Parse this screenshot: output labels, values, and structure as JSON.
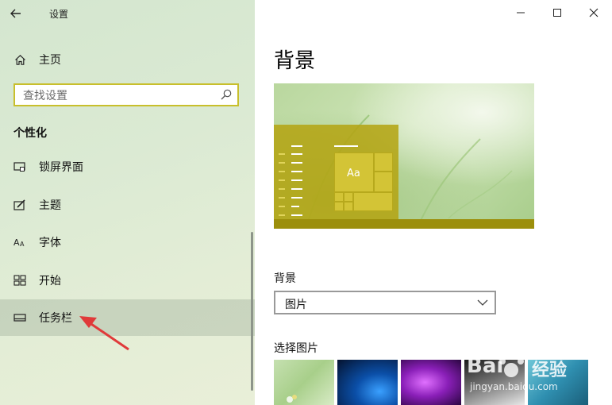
{
  "window": {
    "title": "设置",
    "back_icon": "back-arrow-icon",
    "minimize_glyph": "—",
    "maximize_glyph": "☐",
    "close_glyph": "✕"
  },
  "sidebar": {
    "home_label": "主页",
    "search_placeholder": "查找设置",
    "section_title": "个性化",
    "items": [
      {
        "label": "锁屏界面",
        "icon": "lock-screen-icon"
      },
      {
        "label": "主题",
        "icon": "theme-brush-icon"
      },
      {
        "label": "字体",
        "icon": "font-aa-icon"
      },
      {
        "label": "开始",
        "icon": "start-tiles-icon"
      },
      {
        "label": "任务栏",
        "icon": "taskbar-icon",
        "active": true
      }
    ]
  },
  "main": {
    "page_title": "背景",
    "preview_tile_text": "Aa",
    "background_label": "背景",
    "background_value": "图片",
    "choose_picture_label": "选择图片"
  },
  "watermark": {
    "brand": "Bai",
    "brand_suffix": "经验",
    "site": "jingyan.baidu.com"
  },
  "colors": {
    "accent": "#c8bf2c",
    "preview_start": "#b4a514",
    "annotation_arrow": "#e03a3a"
  }
}
